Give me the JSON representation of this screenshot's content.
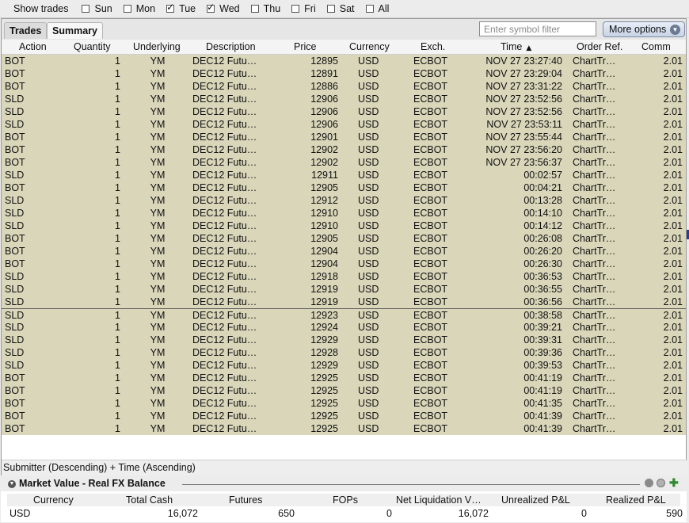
{
  "filter": {
    "label": "Show trades",
    "days": [
      {
        "label": "Sun",
        "checked": false
      },
      {
        "label": "Mon",
        "checked": false
      },
      {
        "label": "Tue",
        "checked": true
      },
      {
        "label": "Wed",
        "checked": true
      },
      {
        "label": "Thu",
        "checked": false
      },
      {
        "label": "Fri",
        "checked": false
      },
      {
        "label": "Sat",
        "checked": false
      },
      {
        "label": "All",
        "checked": false
      }
    ]
  },
  "tabs": [
    {
      "label": "Trades",
      "active": false
    },
    {
      "label": "Summary",
      "active": true
    }
  ],
  "search": {
    "placeholder": "Enter symbol filter",
    "value": ""
  },
  "more_options_label": "More options",
  "columns": [
    "Action",
    "Quantity",
    "Underlying",
    "Description",
    "Price",
    "Currency",
    "Exch.",
    "Time",
    "Order Ref.",
    "Comm"
  ],
  "sorted_column": "Time",
  "trades": [
    {
      "action": "BOT",
      "qty": "1",
      "und": "YM",
      "desc": "DEC12 Futu…",
      "price": "12895",
      "cur": "USD",
      "exch": "ECBOT",
      "time": "NOV 27 23:27:40",
      "ref": "ChartTr…",
      "comm": "2.01"
    },
    {
      "action": "BOT",
      "qty": "1",
      "und": "YM",
      "desc": "DEC12 Futu…",
      "price": "12891",
      "cur": "USD",
      "exch": "ECBOT",
      "time": "NOV 27 23:29:04",
      "ref": "ChartTr…",
      "comm": "2.01"
    },
    {
      "action": "BOT",
      "qty": "1",
      "und": "YM",
      "desc": "DEC12 Futu…",
      "price": "12886",
      "cur": "USD",
      "exch": "ECBOT",
      "time": "NOV 27 23:31:22",
      "ref": "ChartTr…",
      "comm": "2.01"
    },
    {
      "action": "SLD",
      "qty": "1",
      "und": "YM",
      "desc": "DEC12 Futu…",
      "price": "12906",
      "cur": "USD",
      "exch": "ECBOT",
      "time": "NOV 27 23:52:56",
      "ref": "ChartTr…",
      "comm": "2.01"
    },
    {
      "action": "SLD",
      "qty": "1",
      "und": "YM",
      "desc": "DEC12 Futu…",
      "price": "12906",
      "cur": "USD",
      "exch": "ECBOT",
      "time": "NOV 27 23:52:56",
      "ref": "ChartTr…",
      "comm": "2.01"
    },
    {
      "action": "SLD",
      "qty": "1",
      "und": "YM",
      "desc": "DEC12 Futu…",
      "price": "12906",
      "cur": "USD",
      "exch": "ECBOT",
      "time": "NOV 27 23:53:11",
      "ref": "ChartTr…",
      "comm": "2.01"
    },
    {
      "action": "BOT",
      "qty": "1",
      "und": "YM",
      "desc": "DEC12 Futu…",
      "price": "12901",
      "cur": "USD",
      "exch": "ECBOT",
      "time": "NOV 27 23:55:44",
      "ref": "ChartTr…",
      "comm": "2.01"
    },
    {
      "action": "BOT",
      "qty": "1",
      "und": "YM",
      "desc": "DEC12 Futu…",
      "price": "12902",
      "cur": "USD",
      "exch": "ECBOT",
      "time": "NOV 27 23:56:20",
      "ref": "ChartTr…",
      "comm": "2.01"
    },
    {
      "action": "BOT",
      "qty": "1",
      "und": "YM",
      "desc": "DEC12 Futu…",
      "price": "12902",
      "cur": "USD",
      "exch": "ECBOT",
      "time": "NOV 27 23:56:37",
      "ref": "ChartTr…",
      "comm": "2.01"
    },
    {
      "action": "SLD",
      "qty": "1",
      "und": "YM",
      "desc": "DEC12 Futu…",
      "price": "12911",
      "cur": "USD",
      "exch": "ECBOT",
      "time": "00:02:57",
      "ref": "ChartTr…",
      "comm": "2.01"
    },
    {
      "action": "BOT",
      "qty": "1",
      "und": "YM",
      "desc": "DEC12 Futu…",
      "price": "12905",
      "cur": "USD",
      "exch": "ECBOT",
      "time": "00:04:21",
      "ref": "ChartTr…",
      "comm": "2.01"
    },
    {
      "action": "SLD",
      "qty": "1",
      "und": "YM",
      "desc": "DEC12 Futu…",
      "price": "12912",
      "cur": "USD",
      "exch": "ECBOT",
      "time": "00:13:28",
      "ref": "ChartTr…",
      "comm": "2.01"
    },
    {
      "action": "SLD",
      "qty": "1",
      "und": "YM",
      "desc": "DEC12 Futu…",
      "price": "12910",
      "cur": "USD",
      "exch": "ECBOT",
      "time": "00:14:10",
      "ref": "ChartTr…",
      "comm": "2.01"
    },
    {
      "action": "SLD",
      "qty": "1",
      "und": "YM",
      "desc": "DEC12 Futu…",
      "price": "12910",
      "cur": "USD",
      "exch": "ECBOT",
      "time": "00:14:12",
      "ref": "ChartTr…",
      "comm": "2.01"
    },
    {
      "action": "BOT",
      "qty": "1",
      "und": "YM",
      "desc": "DEC12 Futu…",
      "price": "12905",
      "cur": "USD",
      "exch": "ECBOT",
      "time": "00:26:08",
      "ref": "ChartTr…",
      "comm": "2.01"
    },
    {
      "action": "BOT",
      "qty": "1",
      "und": "YM",
      "desc": "DEC12 Futu…",
      "price": "12904",
      "cur": "USD",
      "exch": "ECBOT",
      "time": "00:26:20",
      "ref": "ChartTr…",
      "comm": "2.01"
    },
    {
      "action": "BOT",
      "qty": "1",
      "und": "YM",
      "desc": "DEC12 Futu…",
      "price": "12904",
      "cur": "USD",
      "exch": "ECBOT",
      "time": "00:26:30",
      "ref": "ChartTr…",
      "comm": "2.01"
    },
    {
      "action": "SLD",
      "qty": "1",
      "und": "YM",
      "desc": "DEC12 Futu…",
      "price": "12918",
      "cur": "USD",
      "exch": "ECBOT",
      "time": "00:36:53",
      "ref": "ChartTr…",
      "comm": "2.01"
    },
    {
      "action": "SLD",
      "qty": "1",
      "und": "YM",
      "desc": "DEC12 Futu…",
      "price": "12919",
      "cur": "USD",
      "exch": "ECBOT",
      "time": "00:36:55",
      "ref": "ChartTr…",
      "comm": "2.01"
    },
    {
      "action": "SLD",
      "qty": "1",
      "und": "YM",
      "desc": "DEC12 Futu…",
      "price": "12919",
      "cur": "USD",
      "exch": "ECBOT",
      "time": "00:36:56",
      "ref": "ChartTr…",
      "comm": "2.01"
    },
    {
      "action": "SLD",
      "qty": "1",
      "und": "YM",
      "desc": "DEC12 Futu…",
      "price": "12923",
      "cur": "USD",
      "exch": "ECBOT",
      "time": "00:38:58",
      "ref": "ChartTr…",
      "comm": "2.01"
    },
    {
      "action": "SLD",
      "qty": "1",
      "und": "YM",
      "desc": "DEC12 Futu…",
      "price": "12924",
      "cur": "USD",
      "exch": "ECBOT",
      "time": "00:39:21",
      "ref": "ChartTr…",
      "comm": "2.01"
    },
    {
      "action": "SLD",
      "qty": "1",
      "und": "YM",
      "desc": "DEC12 Futu…",
      "price": "12929",
      "cur": "USD",
      "exch": "ECBOT",
      "time": "00:39:31",
      "ref": "ChartTr…",
      "comm": "2.01"
    },
    {
      "action": "SLD",
      "qty": "1",
      "und": "YM",
      "desc": "DEC12 Futu…",
      "price": "12928",
      "cur": "USD",
      "exch": "ECBOT",
      "time": "00:39:36",
      "ref": "ChartTr…",
      "comm": "2.01"
    },
    {
      "action": "SLD",
      "qty": "1",
      "und": "YM",
      "desc": "DEC12 Futu…",
      "price": "12929",
      "cur": "USD",
      "exch": "ECBOT",
      "time": "00:39:53",
      "ref": "ChartTr…",
      "comm": "2.01"
    },
    {
      "action": "BOT",
      "qty": "1",
      "und": "YM",
      "desc": "DEC12 Futu…",
      "price": "12925",
      "cur": "USD",
      "exch": "ECBOT",
      "time": "00:41:19",
      "ref": "ChartTr…",
      "comm": "2.01"
    },
    {
      "action": "BOT",
      "qty": "1",
      "und": "YM",
      "desc": "DEC12 Futu…",
      "price": "12925",
      "cur": "USD",
      "exch": "ECBOT",
      "time": "00:41:19",
      "ref": "ChartTr…",
      "comm": "2.01"
    },
    {
      "action": "BOT",
      "qty": "1",
      "und": "YM",
      "desc": "DEC12 Futu…",
      "price": "12925",
      "cur": "USD",
      "exch": "ECBOT",
      "time": "00:41:35",
      "ref": "ChartTr…",
      "comm": "2.01"
    },
    {
      "action": "BOT",
      "qty": "1",
      "und": "YM",
      "desc": "DEC12 Futu…",
      "price": "12925",
      "cur": "USD",
      "exch": "ECBOT",
      "time": "00:41:39",
      "ref": "ChartTr…",
      "comm": "2.01"
    },
    {
      "action": "BOT",
      "qty": "1",
      "und": "YM",
      "desc": "DEC12 Futu…",
      "price": "12925",
      "cur": "USD",
      "exch": "ECBOT",
      "time": "00:41:39",
      "ref": "ChartTr…",
      "comm": "2.01"
    }
  ],
  "sort_description": "Submitter (Descending)  +  Time (Ascending)",
  "market_value": {
    "title": "Market Value - Real FX Balance",
    "columns": [
      "Currency",
      "Total Cash",
      "Futures",
      "FOPs",
      "Net Liquidation V…",
      "Unrealized P&L",
      "Realized P&L"
    ],
    "row": [
      "USD",
      "16,072",
      "650",
      "0",
      "16,072",
      "0",
      "590"
    ]
  },
  "colors": {
    "row_background": "#d9d6b9",
    "button_accent": "#7d8ca6"
  },
  "icons": {
    "sort": "sort-up-icon",
    "more_options": "chevron-down-circle-icon",
    "collapse": "collapse-arrow-icon"
  }
}
